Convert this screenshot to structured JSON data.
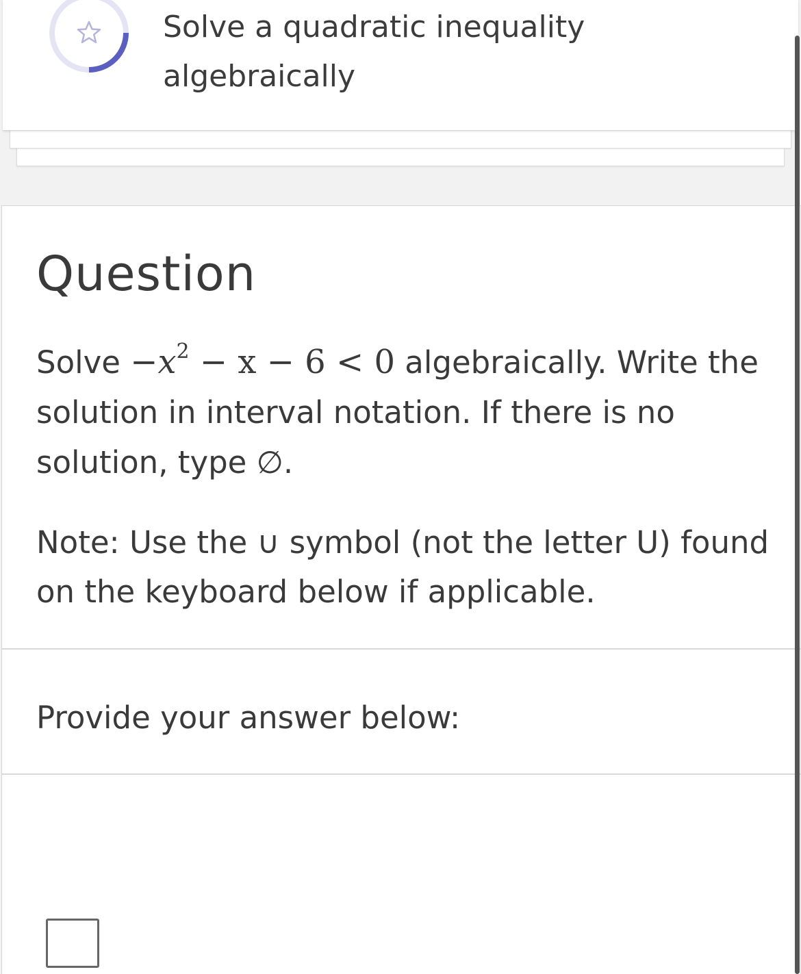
{
  "header": {
    "title": "Solve a quadratic inequality algebraically",
    "progress_icon": "star-icon",
    "ring_track_color": "#e4e4f4",
    "ring_progress_color": "#5b5fbf"
  },
  "question": {
    "heading": "Question",
    "prompt_prefix": "Solve",
    "expression": {
      "minus": "−",
      "variable": "x",
      "exponent": "2",
      "rest": " − x − 6 < 0"
    },
    "prompt_suffix": "algebraically. Write the solution in interval notation. If there is no solution, type ∅.",
    "note_prefix": "Note: Use the",
    "union_symbol": "∪",
    "note_suffix": "symbol (not the letter U) found on the keyboard below if applicable."
  },
  "answer": {
    "label": "Provide your answer below:",
    "value": ""
  }
}
